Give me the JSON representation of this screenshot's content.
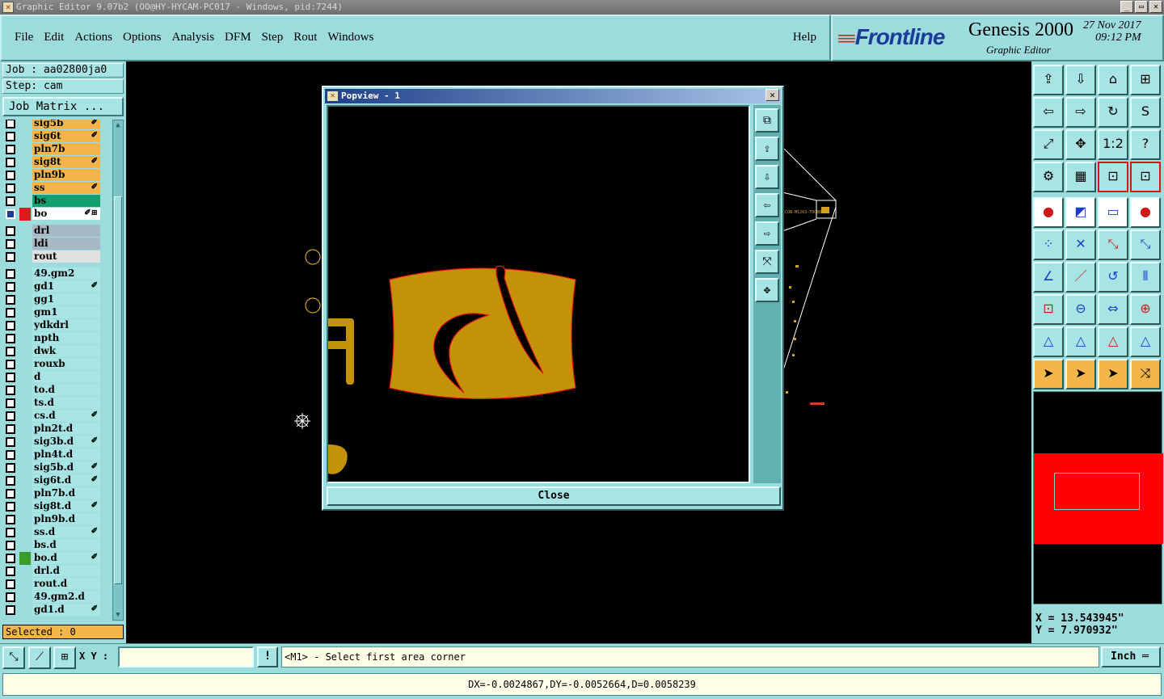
{
  "window": {
    "title": "Graphic Editor 9.07b2 (OO@HY-HYCAM-PC017 - Windows, pid:7244)",
    "minimize": "_",
    "maximize": "▭",
    "close": "✕"
  },
  "menu": {
    "items": [
      "File",
      "Edit",
      "Actions",
      "Options",
      "Analysis",
      "DFM",
      "Step",
      "Rout",
      "Windows"
    ],
    "help": "Help"
  },
  "brand": {
    "logo": "Frontline",
    "product": "Genesis 2000",
    "subtitle": "Graphic Editor",
    "date": "27 Nov 2017",
    "time": "09:12 PM"
  },
  "job": {
    "job_label": "Job : aa02800ja0",
    "step_label": "Step: cam",
    "matrix_button": "Job Matrix ..."
  },
  "layers": [
    {
      "name": "sig5b",
      "color": "#f4b64a",
      "mark": "✐"
    },
    {
      "name": "sig6t",
      "color": "#f4b64a",
      "mark": "✐"
    },
    {
      "name": "pln7b",
      "color": "#f4b64a",
      "mark": ""
    },
    {
      "name": "sig8t",
      "color": "#f4b64a",
      "mark": "✐"
    },
    {
      "name": "pln9b",
      "color": "#f4b64a",
      "mark": ""
    },
    {
      "name": "ss",
      "color": "#f4b64a",
      "mark": "✐"
    },
    {
      "name": "bs",
      "color": "#12a070",
      "mark": ""
    },
    {
      "name": "bo",
      "color": "#ffffff",
      "mark": "✐⊞",
      "active": true
    },
    {
      "name": "drl",
      "color": "#a8b8c4",
      "mark": ""
    },
    {
      "name": "ldi",
      "color": "#a8b8c4",
      "mark": ""
    },
    {
      "name": "rout",
      "color": "#e0e0e0",
      "mark": ""
    },
    {
      "name": "49.gm2",
      "color": "#a8e4e4",
      "mark": ""
    },
    {
      "name": "gd1",
      "color": "#a8e4e4",
      "mark": "✐"
    },
    {
      "name": "gg1",
      "color": "#a8e4e4",
      "mark": ""
    },
    {
      "name": "gm1",
      "color": "#a8e4e4",
      "mark": ""
    },
    {
      "name": "ydkdrl",
      "color": "#a8e4e4",
      "mark": ""
    },
    {
      "name": "npth",
      "color": "#a8e4e4",
      "mark": ""
    },
    {
      "name": "dwk",
      "color": "#a8e4e4",
      "mark": ""
    },
    {
      "name": "rouxb",
      "color": "#a8e4e4",
      "mark": ""
    },
    {
      "name": "d",
      "color": "#a8e4e4",
      "mark": ""
    },
    {
      "name": "to.d",
      "color": "#a8e4e4",
      "mark": ""
    },
    {
      "name": "ts.d",
      "color": "#a8e4e4",
      "mark": ""
    },
    {
      "name": "cs.d",
      "color": "#a8e4e4",
      "mark": "✐"
    },
    {
      "name": "pln2t.d",
      "color": "#a8e4e4",
      "mark": ""
    },
    {
      "name": "sig3b.d",
      "color": "#a8e4e4",
      "mark": "✐"
    },
    {
      "name": "pln4t.d",
      "color": "#a8e4e4",
      "mark": ""
    },
    {
      "name": "sig5b.d",
      "color": "#a8e4e4",
      "mark": "✐"
    },
    {
      "name": "sig6t.d",
      "color": "#a8e4e4",
      "mark": "✐"
    },
    {
      "name": "pln7b.d",
      "color": "#a8e4e4",
      "mark": ""
    },
    {
      "name": "sig8t.d",
      "color": "#a8e4e4",
      "mark": "✐"
    },
    {
      "name": "pln9b.d",
      "color": "#a8e4e4",
      "mark": ""
    },
    {
      "name": "ss.d",
      "color": "#a8e4e4",
      "mark": "✐"
    },
    {
      "name": "bs.d",
      "color": "#a8e4e4",
      "mark": ""
    },
    {
      "name": "bo.d",
      "color": "#a8e4e4",
      "mark": "✐",
      "affected": "#3a9a2a"
    },
    {
      "name": "drl.d",
      "color": "#a8e4e4",
      "mark": ""
    },
    {
      "name": "rout.d",
      "color": "#a8e4e4",
      "mark": ""
    },
    {
      "name": "49.gm2.d",
      "color": "#a8e4e4",
      "mark": ""
    },
    {
      "name": "gd1.d",
      "color": "#a8e4e4",
      "mark": "✐"
    }
  ],
  "selected": "Selected : 0",
  "popview": {
    "title": "Popview - 1",
    "close_label": "Close",
    "tools": [
      "⧉",
      "⇪",
      "⇩",
      "⇦",
      "⇨",
      "⤧",
      "✥"
    ]
  },
  "toolbar": {
    "view_tools": [
      "⇪",
      "⇩",
      "⌂",
      "⊞",
      "⇦",
      "⇨",
      "↻",
      "S",
      "⤢",
      "✥",
      "1:2",
      "?",
      "⚙",
      "▦",
      "⊡",
      "⊡"
    ],
    "edit_tools": [
      "●",
      "◩",
      "▭",
      "●",
      "⁘",
      "✕",
      "⤡",
      "⤡",
      "∠",
      "／",
      "↺",
      "⫴",
      "⊡",
      "⊖",
      "⇔",
      "⊕",
      "△",
      "△",
      "△",
      "△",
      "➤",
      "➤",
      "➤",
      "⤨"
    ]
  },
  "coords": {
    "x": "X = 13.543945\"",
    "y": "Y = 7.970932\""
  },
  "command": {
    "xy_label": "X Y :",
    "input_value": "",
    "excl": "!",
    "prompt": "<M1> - Select first area corner",
    "units": "Inch ═"
  },
  "status": {
    "text": "DX=-0.0024867,DY=-0.0052664,D=0.0058239"
  },
  "canvas": {
    "label1": "ICON-M1263-TOC8B"
  }
}
